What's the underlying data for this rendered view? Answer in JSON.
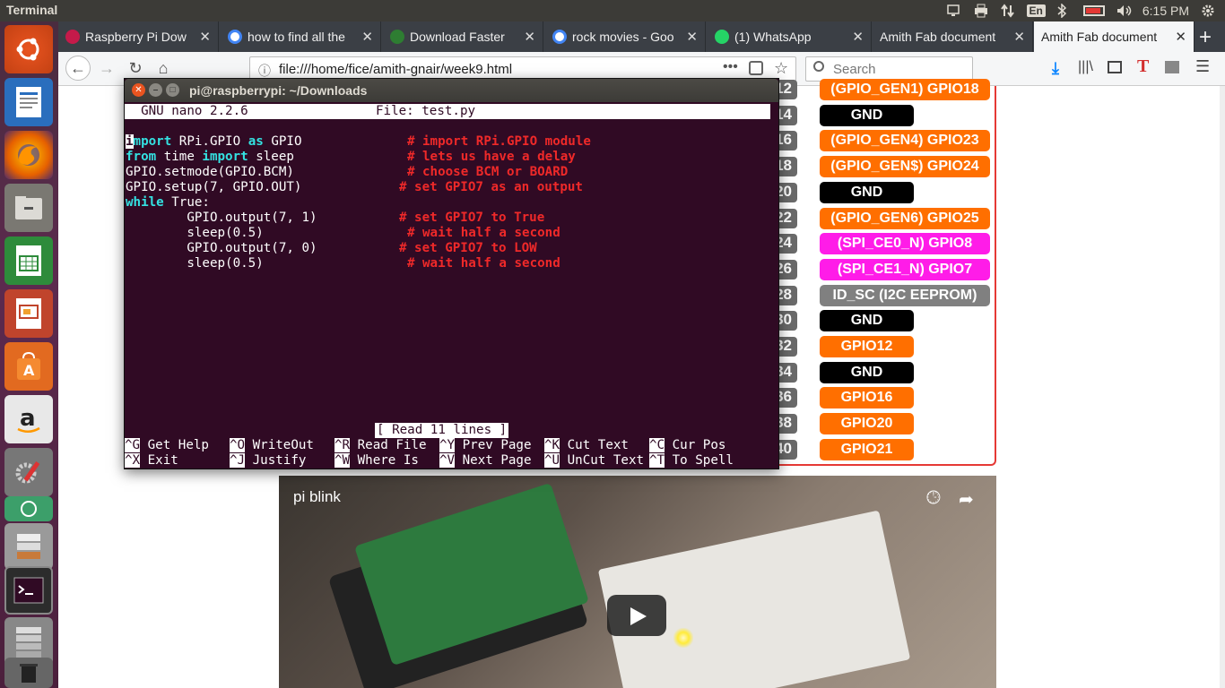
{
  "topbar": {
    "app_title": "Terminal",
    "language": "En",
    "time": "6:15 PM"
  },
  "launcher": {
    "items": [
      "ubuntu",
      "writer",
      "firefox",
      "files",
      "calc",
      "impress",
      "software",
      "amazon",
      "settings",
      "app",
      "stack",
      "terminal",
      "trash"
    ]
  },
  "browser": {
    "tabs": [
      {
        "label": "Raspberry Pi Dow",
        "icon": "raspberry-icon"
      },
      {
        "label": "how to find all the",
        "icon": "google-icon"
      },
      {
        "label": "Download Faster",
        "icon": "download-icon"
      },
      {
        "label": "rock movies - Goo",
        "icon": "google-icon"
      },
      {
        "label": "(1) WhatsApp",
        "icon": "whatsapp-icon"
      },
      {
        "label": "Amith Fab document",
        "icon": "page-icon"
      },
      {
        "label": "Amith Fab document",
        "icon": "page-icon"
      }
    ],
    "url": "file:///home/fice/amith-gnair/week9.html",
    "search_placeholder": "Search"
  },
  "page": {
    "pins": [
      {
        "num": "12",
        "label": "(GPIO_GEN1) GPIO18",
        "color": "#ff6f00"
      },
      {
        "num": "14",
        "label": "GND",
        "color": "#000000"
      },
      {
        "num": "16",
        "label": "(GPIO_GEN4) GPIO23",
        "color": "#ff6f00"
      },
      {
        "num": "18",
        "label": "(GPIO_GEN$) GPIO24",
        "color": "#ff6f00"
      },
      {
        "num": "20",
        "label": "GND",
        "color": "#000000"
      },
      {
        "num": "22",
        "label": "(GPIO_GEN6) GPIO25",
        "color": "#ff6f00"
      },
      {
        "num": "24",
        "label": "(SPI_CE0_N) GPIO8",
        "color": "#ff1ce8"
      },
      {
        "num": "26",
        "label": "(SPI_CE1_N) GPIO7",
        "color": "#ff1ce8"
      },
      {
        "num": "28",
        "label": "ID_SC (I2C EEPROM)",
        "color": "#808080"
      },
      {
        "num": "30",
        "label": "GND",
        "color": "#000000"
      },
      {
        "num": "32",
        "label": "GPIO12",
        "color": "#ff6f00"
      },
      {
        "num": "34",
        "label": "GND",
        "color": "#000000"
      },
      {
        "num": "36",
        "label": "GPIO16",
        "color": "#ff6f00"
      },
      {
        "num": "38",
        "label": "GPIO20",
        "color": "#ff6f00"
      },
      {
        "num": "40",
        "label": "GPIO21",
        "color": "#ff6f00"
      }
    ],
    "video_title": "pi blink"
  },
  "terminal": {
    "title": "pi@raspberrypi: ~/Downloads",
    "nano_version": "  GNU nano 2.2.6",
    "nano_file": "File: test.py",
    "code": [
      {
        "code": [
          {
            "t": "import",
            "k": "kw"
          },
          {
            "t": " RPi.GPIO "
          },
          {
            "t": "as",
            "k": "kw"
          },
          {
            "t": " GPIO"
          }
        ],
        "comment": "# import RPi.GPIO module",
        "ccol": 35
      },
      {
        "code": [
          {
            "t": "from",
            "k": "kw"
          },
          {
            "t": " time "
          },
          {
            "t": "import",
            "k": "kw"
          },
          {
            "t": " sleep"
          }
        ],
        "comment": "# lets us have a delay",
        "ccol": 35
      },
      {
        "code": [
          {
            "t": "GPIO.setmode(GPIO.BCM)"
          }
        ],
        "comment": "# choose BCM or BOARD",
        "ccol": 35
      },
      {
        "code": [
          {
            "t": "GPIO.setup(7, GPIO.OUT)"
          }
        ],
        "comment": "# set GPIO7 as an output",
        "ccol": 34
      },
      {
        "code": [
          {
            "t": "while",
            "k": "kw"
          },
          {
            "t": " True:"
          }
        ],
        "comment": "",
        "ccol": 0
      },
      {
        "code": [
          {
            "t": "        GPIO.output(7, 1)"
          }
        ],
        "comment": "# set GPIO7 to True",
        "ccol": 34
      },
      {
        "code": [
          {
            "t": "        sleep(0.5)"
          }
        ],
        "comment": "# wait half a second",
        "ccol": 35
      },
      {
        "code": [
          {
            "t": "        GPIO.output(7, 0)"
          }
        ],
        "comment": "# set GPIO7 to LOW",
        "ccol": 34
      },
      {
        "code": [
          {
            "t": "        sleep(0.5)"
          }
        ],
        "comment": "# wait half a second",
        "ccol": 35
      }
    ],
    "status": "[ Read 11 lines ]",
    "shortcuts": [
      [
        {
          "key": "^G",
          "label": "Get Help"
        },
        {
          "key": "^O",
          "label": "WriteOut"
        },
        {
          "key": "^R",
          "label": "Read File"
        },
        {
          "key": "^Y",
          "label": "Prev Page"
        },
        {
          "key": "^K",
          "label": "Cut Text"
        },
        {
          "key": "^C",
          "label": "Cur Pos"
        }
      ],
      [
        {
          "key": "^X",
          "label": "Exit"
        },
        {
          "key": "^J",
          "label": "Justify"
        },
        {
          "key": "^W",
          "label": "Where Is"
        },
        {
          "key": "^V",
          "label": "Next Page"
        },
        {
          "key": "^U",
          "label": "UnCut Text"
        },
        {
          "key": "^T",
          "label": "To Spell"
        }
      ]
    ]
  }
}
